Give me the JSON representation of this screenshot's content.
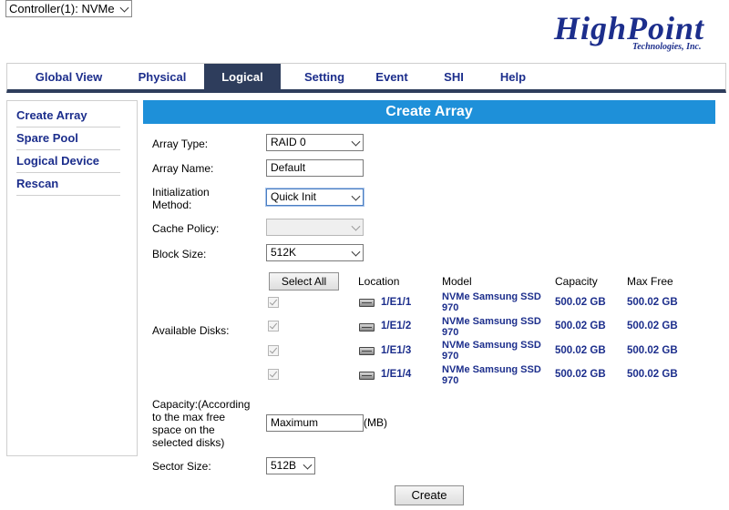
{
  "controller": {
    "selected": "Controller(1): NVMe"
  },
  "logo": {
    "name": "HighPoint",
    "sub": "Technologies, Inc."
  },
  "nav": {
    "tabs": [
      "Global View",
      "Physical",
      "Logical",
      "Setting",
      "Event",
      "SHI",
      "Help"
    ],
    "active": "Logical"
  },
  "sidebar": {
    "items": [
      "Create Array",
      "Spare Pool",
      "Logical Device",
      "Rescan"
    ]
  },
  "form": {
    "title": "Create Array",
    "array_type": {
      "label": "Array Type:",
      "value": "RAID 0"
    },
    "array_name": {
      "label": "Array Name:",
      "value": "Default"
    },
    "init_method": {
      "label_line1": "Initialization",
      "label_line2": "Method:",
      "value": "Quick Init"
    },
    "cache_policy": {
      "label": "Cache Policy:",
      "value": ""
    },
    "block_size": {
      "label": "Block Size:",
      "value": "512K"
    },
    "available_disks": {
      "label": "Available Disks:",
      "select_all": "Select All",
      "headers": {
        "location": "Location",
        "model": "Model",
        "capacity": "Capacity",
        "max_free": "Max Free"
      },
      "rows": [
        {
          "checked": true,
          "location": "1/E1/1",
          "model": "NVMe Samsung SSD 970",
          "capacity": "500.02 GB",
          "max_free": "500.02 GB"
        },
        {
          "checked": true,
          "location": "1/E1/2",
          "model": "NVMe Samsung SSD 970",
          "capacity": "500.02 GB",
          "max_free": "500.02 GB"
        },
        {
          "checked": true,
          "location": "1/E1/3",
          "model": "NVMe Samsung SSD 970",
          "capacity": "500.02 GB",
          "max_free": "500.02 GB"
        },
        {
          "checked": true,
          "location": "1/E1/4",
          "model": "NVMe Samsung SSD 970",
          "capacity": "500.02 GB",
          "max_free": "500.02 GB"
        }
      ]
    },
    "capacity": {
      "label_lines": [
        "Capacity:(According",
        "to the max free",
        "space on the",
        "selected disks)"
      ],
      "value": "Maximum",
      "unit": "(MB)"
    },
    "sector_size": {
      "label": "Sector Size:",
      "value": "512B"
    },
    "create_button": "Create"
  },
  "colors": {
    "accent": "#1e90d9",
    "nav_active": "#2e3d5c",
    "link": "#1c2e8c"
  }
}
